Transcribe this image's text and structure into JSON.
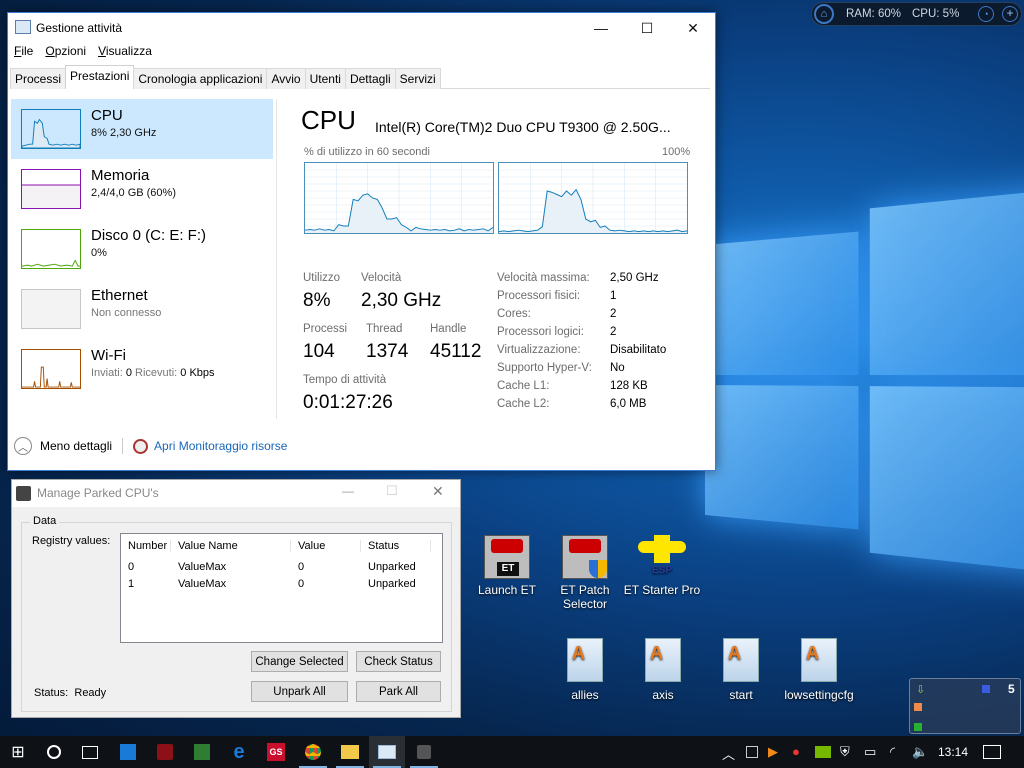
{
  "task_manager": {
    "title": "Gestione attività",
    "controls": {
      "minimize": "—",
      "maximize": "☐",
      "close": "✕"
    },
    "menu": [
      "File",
      "Opzioni",
      "Visualizza"
    ],
    "tabs": [
      "Processi",
      "Prestazioni",
      "Cronologia applicazioni",
      "Avvio",
      "Utenti",
      "Dettagli",
      "Servizi"
    ],
    "active_tab": "Prestazioni",
    "sidebar": [
      {
        "name": "CPU",
        "sub": "8% 2,30 GHz",
        "color": "#117dbb",
        "selected": true
      },
      {
        "name": "Memoria",
        "sub": "2,4/4,0 GB (60%)",
        "color": "#8b12ae"
      },
      {
        "name": "Disco 0 (C: E: F:)",
        "sub": "0%",
        "color": "#4da60c"
      },
      {
        "name": "Ethernet",
        "sub": "Non connesso",
        "color": "#a0a0a0"
      },
      {
        "name": "Wi-Fi",
        "sub_sent_label": "Inviati:",
        "sub_sent": "0",
        "sub_recv_label": "Ricevuti:",
        "sub_recv": "0 Kbps",
        "color": "#a74f01"
      }
    ],
    "main": {
      "title": "CPU",
      "cpu_name": "Intel(R) Core(TM)2 Duo CPU T9300 @ 2.50G...",
      "graph_label": "% di utilizzo in 60 secondi",
      "graph_max": "100%",
      "core0_usage": [
        4,
        5,
        4,
        6,
        4,
        5,
        3,
        12,
        10,
        10,
        48,
        46,
        54,
        56,
        50,
        48,
        36,
        20,
        20,
        22,
        12,
        8,
        3,
        8,
        6,
        5,
        4,
        5,
        4,
        5,
        3,
        4,
        6,
        3,
        5,
        4,
        5,
        6,
        3,
        8
      ],
      "core1_usage": [
        2,
        3,
        2,
        3,
        4,
        3,
        2,
        3,
        4,
        9,
        60,
        58,
        55,
        52,
        60,
        54,
        62,
        48,
        20,
        16,
        18,
        8,
        10,
        4,
        3,
        4,
        3,
        2,
        3,
        2,
        3,
        2,
        3,
        2,
        3,
        2,
        3,
        4,
        2,
        3
      ],
      "stats": {
        "utilizzo_label": "Utilizzo",
        "utilizzo": "8%",
        "velocita_label": "Velocità",
        "velocita": "2,30 GHz",
        "processi_label": "Processi",
        "processi": "104",
        "thread_label": "Thread",
        "thread": "1374",
        "handle_label": "Handle",
        "handle": "45112",
        "uptime_label": "Tempo di attività",
        "uptime": "0:01:27:26"
      },
      "details": [
        {
          "k": "Velocità massima:",
          "v": "2,50 GHz"
        },
        {
          "k": "Processori fisici:",
          "v": "1"
        },
        {
          "k": "Cores:",
          "v": "2"
        },
        {
          "k": "Processori logici:",
          "v": "2"
        },
        {
          "k": "Virtualizzazione:",
          "v": "Disabilitato"
        },
        {
          "k": "Supporto Hyper-V:",
          "v": "No"
        },
        {
          "k": "Cache L1:",
          "v": "128 KB"
        },
        {
          "k": "Cache L2:",
          "v": "6,0 MB"
        }
      ]
    },
    "footer": {
      "less_details": "Meno dettagli",
      "resource_monitor": "Apri Monitoraggio risorse"
    }
  },
  "parked_cpu": {
    "title": "Manage Parked CPU's",
    "group": "Data",
    "registry_label": "Registry values:",
    "columns": [
      "Number",
      "Value Name",
      "Value",
      "Status"
    ],
    "rows": [
      [
        "0",
        "ValueMax",
        "0",
        "Unparked"
      ],
      [
        "1",
        "ValueMax",
        "0",
        "Unparked"
      ]
    ],
    "buttons": {
      "change": "Change Selected",
      "check": "Check Status",
      "unpark": "Unpark All",
      "park": "Park All"
    },
    "status_label": "Status:",
    "status": "Ready"
  },
  "desktop_icons": [
    {
      "label": "Launch ET",
      "type": "et"
    },
    {
      "label": "ET Patch Selector",
      "type": "et-shield"
    },
    {
      "label": "ET Starter Pro",
      "type": "esp"
    },
    {
      "label": "allies",
      "type": "wordpad"
    },
    {
      "label": "axis",
      "type": "wordpad"
    },
    {
      "label": "start",
      "type": "wordpad"
    },
    {
      "label": "lowsettingcfg",
      "type": "wordpad"
    }
  ],
  "widget": {
    "ram": "RAM: 60%",
    "cpu": "CPU: 5%"
  },
  "corner_widget": {
    "count": "5"
  },
  "taskbar": {
    "clock": "13:14"
  }
}
